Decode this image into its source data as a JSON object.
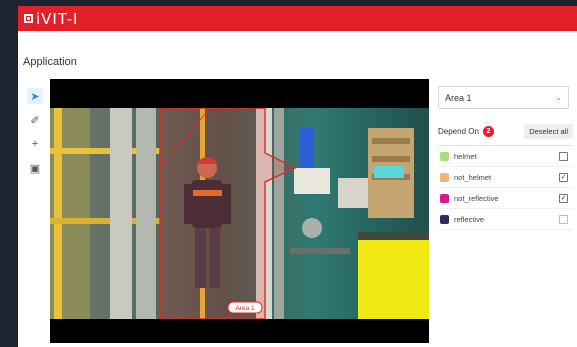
{
  "brand": {
    "logo_text": "iVIT-I",
    "bar_color": "#e3202a"
  },
  "page": {
    "title": "Application"
  },
  "toolbar": {
    "tools": [
      {
        "icon": "navigation-arrow-icon",
        "glyph": "➤",
        "active": true
      },
      {
        "icon": "polygon-draw-icon",
        "glyph": "✐",
        "active": false
      },
      {
        "icon": "plus-icon",
        "glyph": "+",
        "active": false
      },
      {
        "icon": "delete-icon",
        "glyph": "▣",
        "active": false
      }
    ]
  },
  "viewer": {
    "area_tag": "Area 1"
  },
  "panel": {
    "area_select": {
      "value": "Area 1"
    },
    "depend_on": {
      "label": "Depend On",
      "count": "2",
      "deselect_label": "Deselect all"
    },
    "labels": [
      {
        "name": "helmet",
        "color": "#a6de7d",
        "checked": false
      },
      {
        "name": "not_helmet",
        "color": "#f0b27a",
        "checked": true
      },
      {
        "name": "not_reflective",
        "color": "#d81b8c",
        "checked": true
      },
      {
        "name": "reflective",
        "color": "#2b2f5e",
        "checked": false
      }
    ]
  }
}
